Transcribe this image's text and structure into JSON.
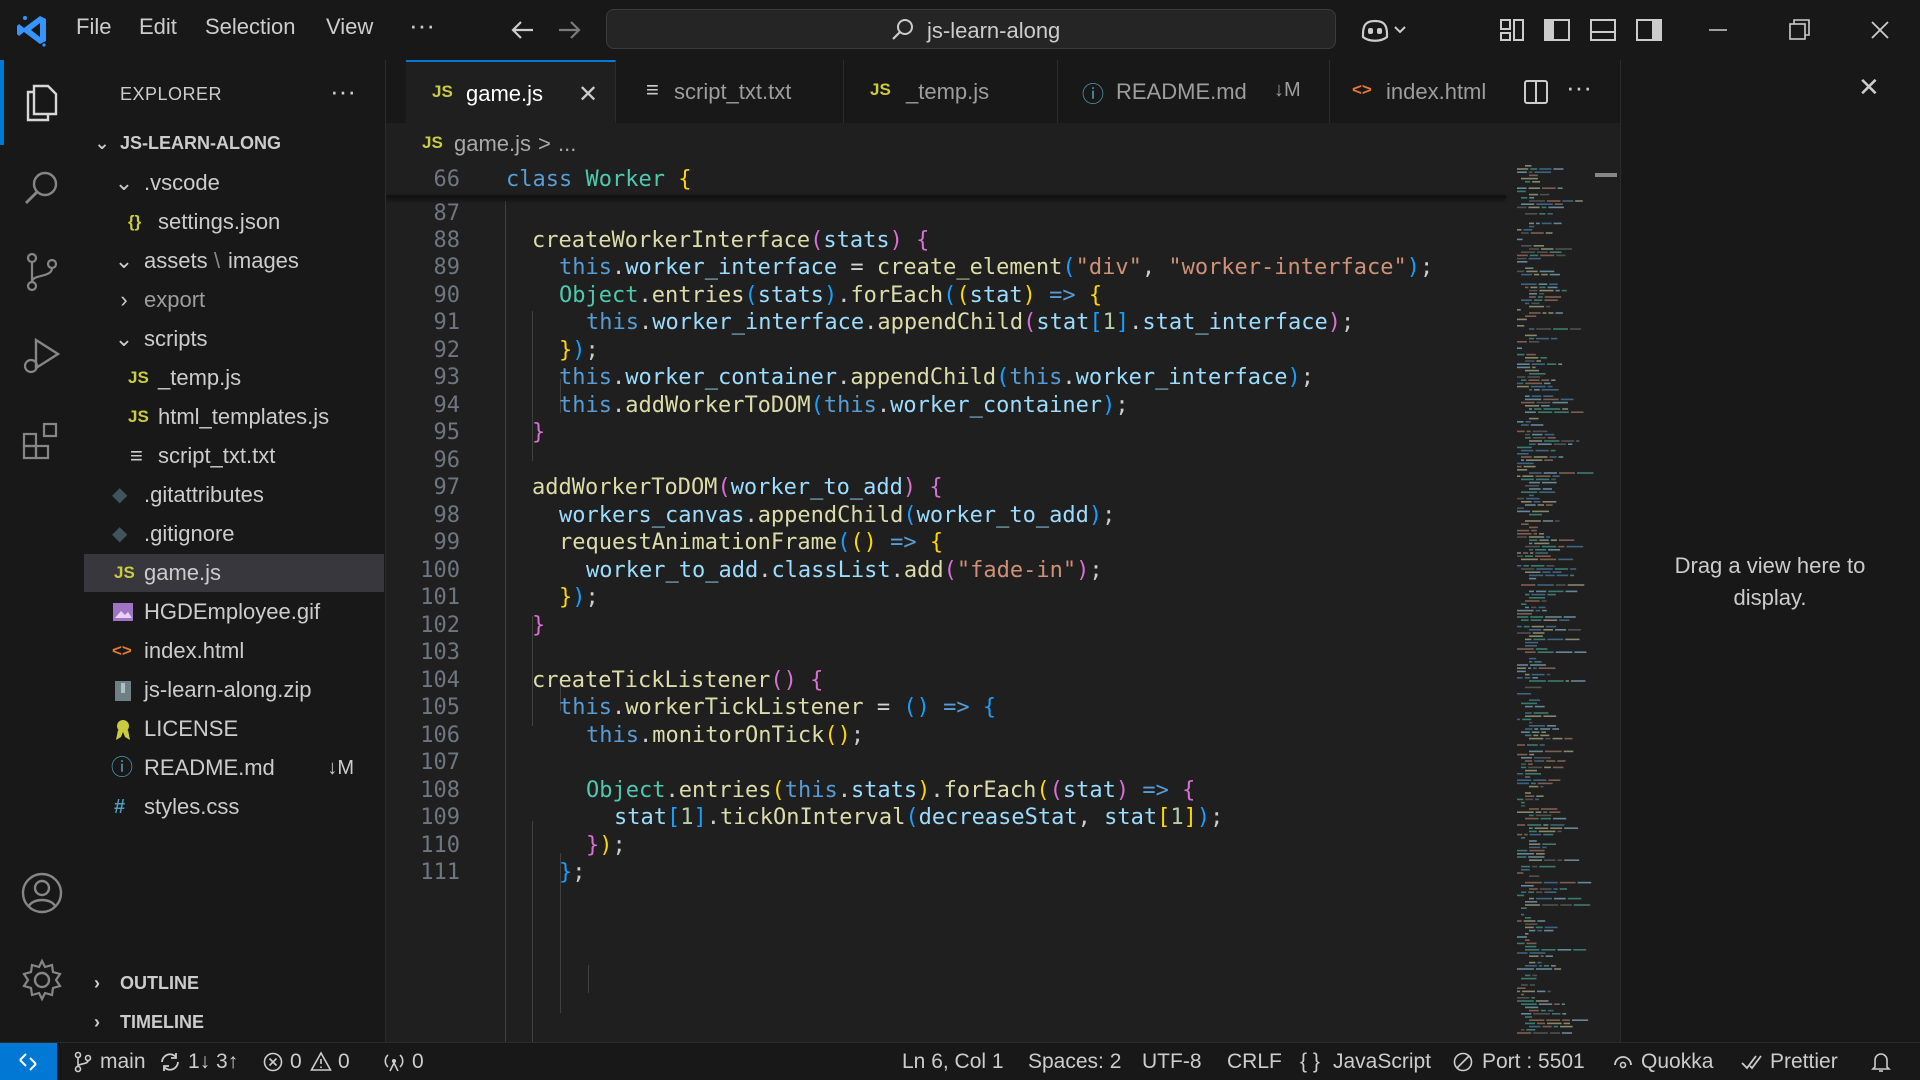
{
  "titlebar": {
    "menu": [
      "File",
      "Edit",
      "Selection",
      "View",
      "···"
    ],
    "search_text": "js-learn-along"
  },
  "sidebar": {
    "title": "EXPLORER",
    "more": "···",
    "root": "JS-LEARN-ALONG",
    "items": [
      {
        "label": ".vscode",
        "kind": "folder-open"
      },
      {
        "label": "settings.json",
        "kind": "json",
        "icon_text": "{}"
      },
      {
        "label": "assets",
        "label2": "images",
        "kind": "folder-open"
      },
      {
        "label": "export",
        "kind": "folder-closed"
      },
      {
        "label": "scripts",
        "kind": "folder-open"
      },
      {
        "label": "_temp.js",
        "kind": "js",
        "icon_text": "JS"
      },
      {
        "label": "html_templates.js",
        "kind": "js",
        "icon_text": "JS"
      },
      {
        "label": "script_txt.txt",
        "kind": "txt",
        "icon_text": "≡"
      },
      {
        "label": ".gitattributes",
        "kind": "git",
        "icon_text": "◆"
      },
      {
        "label": ".gitignore",
        "kind": "git",
        "icon_text": "◆"
      },
      {
        "label": "game.js",
        "kind": "js",
        "icon_text": "JS"
      },
      {
        "label": "HGDEmployee.gif",
        "kind": "image"
      },
      {
        "label": "index.html",
        "kind": "html",
        "icon_text": "<>"
      },
      {
        "label": "js-learn-along.zip",
        "kind": "zip"
      },
      {
        "label": "LICENSE",
        "kind": "license"
      },
      {
        "label": "README.md",
        "kind": "info",
        "icon_text": "ⓘ",
        "badge": "↓M"
      },
      {
        "label": "styles.css",
        "kind": "css",
        "icon_text": "#"
      }
    ],
    "sections": [
      "OUTLINE",
      "TIMELINE"
    ]
  },
  "tabs": [
    {
      "label": "game.js",
      "icon_text": "JS",
      "close": "✕"
    },
    {
      "label": "script_txt.txt",
      "icon_text": "≡"
    },
    {
      "label": "_temp.js",
      "icon_text": "JS"
    },
    {
      "label": "README.md",
      "icon_text": "ⓘ",
      "badge": "↓M"
    },
    {
      "label": "index.html",
      "icon_text": "<>"
    }
  ],
  "tab_actions_more": "···",
  "breadcrumb": {
    "icon_text": "JS",
    "file": "game.js",
    "sep": ">",
    "rest": "..."
  },
  "editor": {
    "line_numbers": [
      "66",
      "87",
      "88",
      "89",
      "90",
      "91",
      "92",
      "93",
      "94",
      "95",
      "96",
      "97",
      "98",
      "99",
      "100",
      "101",
      "102",
      "103",
      "104",
      "105",
      "106",
      "107",
      "108",
      "109",
      "110",
      "111"
    ]
  },
  "aux": {
    "close": "✕",
    "message": "Drag a view here to display."
  },
  "statusbar": {
    "branch": "main",
    "sync": "1↓ 3↑",
    "errors": "0",
    "warnings": "0",
    "ports": "0",
    "position": "Ln 6, Col 1",
    "spaces": "Spaces: 2",
    "encoding": "UTF-8",
    "eol": "CRLF",
    "language": "JavaScript",
    "port": "Port : 5501",
    "quokka": "Quokka",
    "prettier": "Prettier"
  },
  "colors": {
    "accent": "#0078d4",
    "bg_editor": "#1f1f1f",
    "bg_panel": "#181818",
    "js_icon": "#cbcb41",
    "html_icon": "#e37933",
    "css_icon": "#519aba"
  }
}
